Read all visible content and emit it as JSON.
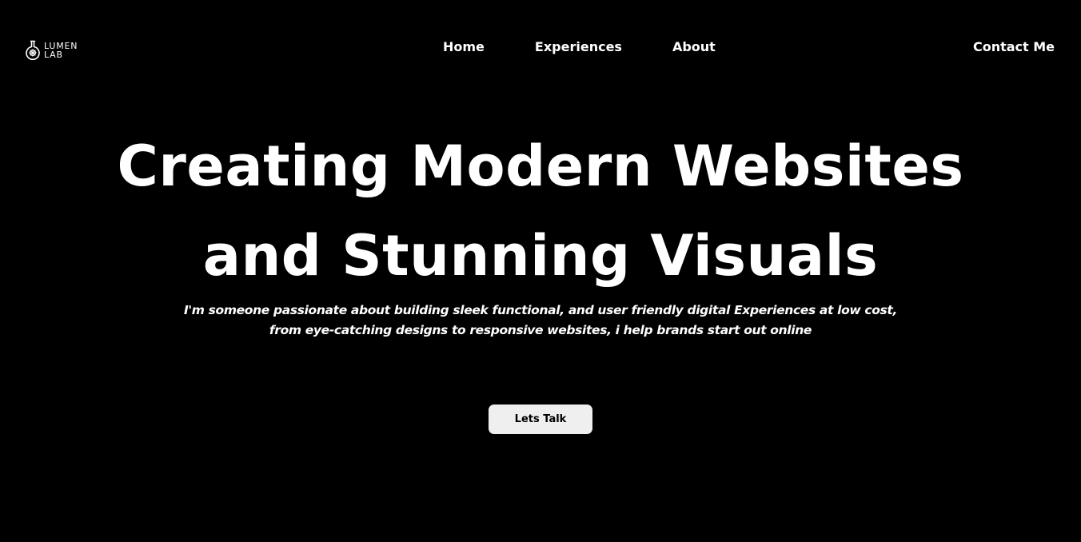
{
  "brand": {
    "line1": "LUMEN",
    "line2": "LAB",
    "icon": "lab-flask-icon"
  },
  "nav": {
    "items": [
      {
        "label": "Home"
      },
      {
        "label": "Experiences"
      },
      {
        "label": "About"
      }
    ],
    "contact_label": "Contact Me"
  },
  "hero": {
    "title_line1": "Creating Modern Websites",
    "title_line2": "and Stunning Visuals",
    "subtitle": "I'm someone passionate about building sleek functional, and user friendly digital Experiences at low cost, from eye-catching designs to responsive websites, i help brands start out online",
    "cta_label": "Lets Talk"
  },
  "colors": {
    "background": "#000000",
    "text": "#ffffff",
    "button_bg": "#efefef",
    "button_text": "#000000"
  }
}
